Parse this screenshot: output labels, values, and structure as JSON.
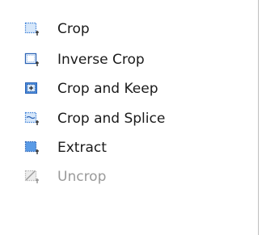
{
  "menu": {
    "items": [
      {
        "label": "Crop",
        "icon": "crop-icon",
        "enabled": true
      },
      {
        "label": "Inverse Crop",
        "icon": "inverse-crop-icon",
        "enabled": true
      },
      {
        "label": "Crop and Keep",
        "icon": "crop-and-keep-icon",
        "enabled": true
      },
      {
        "label": "Crop and Splice",
        "icon": "crop-and-splice-icon",
        "enabled": true
      },
      {
        "label": "Extract",
        "icon": "extract-icon",
        "enabled": true
      },
      {
        "label": "Uncrop",
        "icon": "uncrop-icon",
        "enabled": false
      }
    ]
  },
  "colors": {
    "icon_blue": "#3c7fd6",
    "icon_fill": "#cfe2f7",
    "disabled_text": "#9a9a9a",
    "text": "#1a1a1a",
    "border": "#bfbfbf"
  }
}
